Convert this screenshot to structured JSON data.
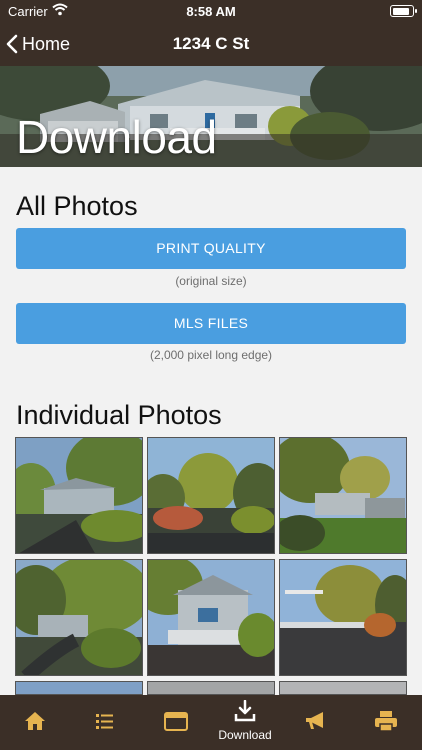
{
  "status_bar": {
    "carrier": "Carrier",
    "time": "8:58 AM",
    "battery_level": 0.9
  },
  "nav": {
    "back_label": "Home",
    "title": "1234 C St"
  },
  "hero": {
    "title": "Download"
  },
  "all_photos": {
    "title": "All Photos",
    "print_button": "PRINT QUALITY",
    "print_note": "(original size)",
    "mls_button": "MLS FILES",
    "mls_note": "(2,000 pixel long edge)"
  },
  "individual": {
    "title": "Individual Photos"
  },
  "tabs": [
    {
      "icon": "home-icon",
      "label": ""
    },
    {
      "icon": "list-icon",
      "label": ""
    },
    {
      "icon": "browser-icon",
      "label": ""
    },
    {
      "icon": "download-icon",
      "label": "Download"
    },
    {
      "icon": "megaphone-icon",
      "label": ""
    },
    {
      "icon": "printer-icon",
      "label": ""
    }
  ],
  "colors": {
    "bar": "#3b2f27",
    "accent": "#4a9ee0",
    "tab_icon": "#e6b450",
    "tab_active": "#ffffff"
  }
}
